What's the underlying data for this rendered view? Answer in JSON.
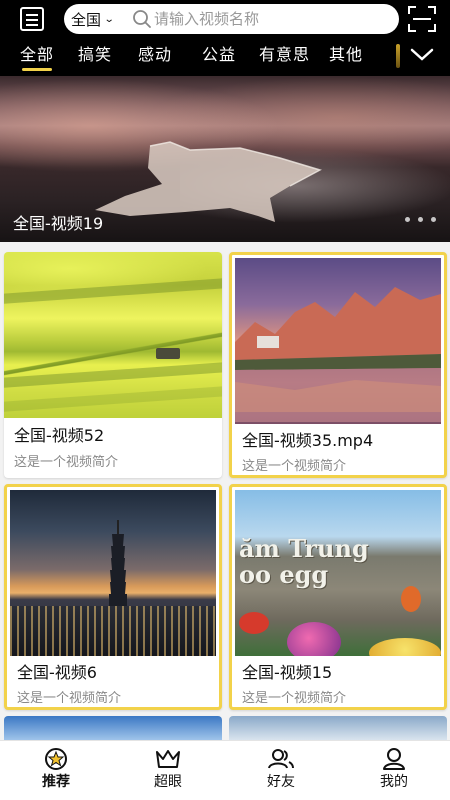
{
  "header": {
    "region": "全国",
    "search_placeholder": "请输入视频名称",
    "tabs": [
      {
        "label": "全部",
        "active": true
      },
      {
        "label": "搞笑",
        "active": false
      },
      {
        "label": "感动",
        "active": false
      },
      {
        "label": "公益",
        "active": false
      },
      {
        "label": "有意思",
        "active": false
      },
      {
        "label": "其他",
        "active": false
      }
    ]
  },
  "banner": {
    "caption": "全国-视频19",
    "page_indicator_count": 3
  },
  "videos": [
    {
      "title": "全国-视频52",
      "desc": "这是一个视频简介",
      "highlighted": false,
      "thumb": "rapeseed-field"
    },
    {
      "title": "全国-视频35.mp4",
      "desc": "这是一个视频简介",
      "highlighted": true,
      "thumb": "mountain-lake"
    },
    {
      "title": "全国-视频6",
      "desc": "这是一个视频简介",
      "highlighted": true,
      "thumb": "city-sunset"
    },
    {
      "title": "全国-视频15",
      "desc": "这是一个视频简介",
      "highlighted": true,
      "thumb": "easter-eggs-rock"
    }
  ],
  "rock_sign_text": "ăm Trung\noo egg",
  "bottom_nav": [
    {
      "label": "推荐",
      "icon": "star-badge-icon",
      "active": true
    },
    {
      "label": "超眼",
      "icon": "crown-icon",
      "active": false
    },
    {
      "label": "好友",
      "icon": "friends-icon",
      "active": false
    },
    {
      "label": "我的",
      "icon": "profile-icon",
      "active": false
    }
  ],
  "colors": {
    "header_bg": "#000000",
    "accent": "#f2d24a",
    "page_bg": "#f2f2f2"
  }
}
